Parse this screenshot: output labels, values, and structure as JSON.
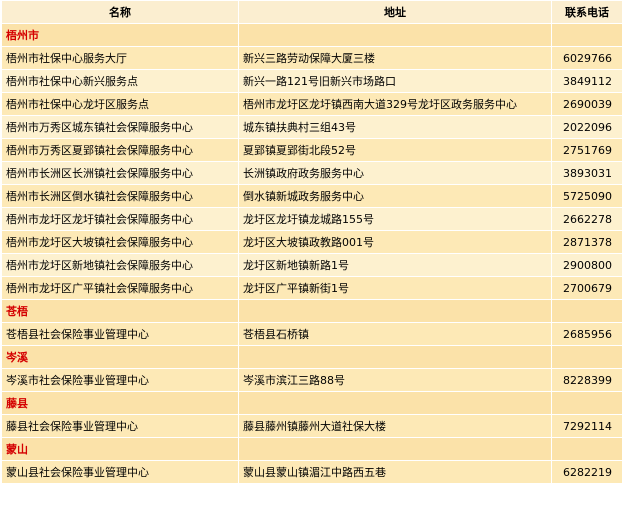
{
  "headers": {
    "name": "名称",
    "address": "地址",
    "phone": "联系电话"
  },
  "sections": [
    {
      "title": "梧州市",
      "rows": [
        {
          "name": "梧州市社保中心服务大厅",
          "address": "新兴三路劳动保障大厦三楼",
          "phone": "6029766"
        },
        {
          "name": "梧州市社保中心新兴服务点",
          "address": "新兴一路121号旧新兴市场路口",
          "phone": "3849112"
        },
        {
          "name": "梧州市社保中心龙圩区服务点",
          "address": "梧州市龙圩区龙圩镇西南大道329号龙圩区政务服务中心",
          "phone": "2690039"
        },
        {
          "name": "梧州市万秀区城东镇社会保障服务中心",
          "address": "城东镇扶典村三组43号",
          "phone": "2022096"
        },
        {
          "name": "梧州市万秀区夏郢镇社会保障服务中心",
          "address": "夏郢镇夏郢街北段52号",
          "phone": "2751769"
        },
        {
          "name": "梧州市长洲区长洲镇社会保障服务中心",
          "address": "长洲镇政府政务服务中心",
          "phone": "3893031"
        },
        {
          "name": "梧州市长洲区倒水镇社会保障服务中心",
          "address": "倒水镇新城政务服务中心",
          "phone": "5725090"
        },
        {
          "name": "梧州市龙圩区龙圩镇社会保障服务中心",
          "address": "龙圩区龙圩镇龙城路155号",
          "phone": "2662278"
        },
        {
          "name": "梧州市龙圩区大坡镇社会保障服务中心",
          "address": "龙圩区大坡镇政教路001号",
          "phone": "2871378"
        },
        {
          "name": "梧州市龙圩区新地镇社会保障服务中心",
          "address": "龙圩区新地镇新路1号",
          "phone": "2900800"
        },
        {
          "name": "梧州市龙圩区广平镇社会保障服务中心",
          "address": "龙圩区广平镇新街1号",
          "phone": "2700679"
        }
      ]
    },
    {
      "title": "苍梧",
      "rows": [
        {
          "name": "苍梧县社会保险事业管理中心",
          "address": "苍梧县石桥镇",
          "phone": "2685956"
        }
      ]
    },
    {
      "title": "岑溪",
      "rows": [
        {
          "name": "岑溪市社会保险事业管理中心",
          "address": "岑溪市滨江三路88号",
          "phone": "8228399"
        }
      ]
    },
    {
      "title": "藤县",
      "rows": [
        {
          "name": "藤县社会保险事业管理中心",
          "address": "藤县藤州镇藤州大道社保大楼",
          "phone": "7292114"
        }
      ]
    },
    {
      "title": "蒙山",
      "rows": [
        {
          "name": "蒙山县社会保险事业管理中心",
          "address": "蒙山县蒙山镇湄江中路西五巷",
          "phone": "6282219"
        }
      ]
    }
  ]
}
